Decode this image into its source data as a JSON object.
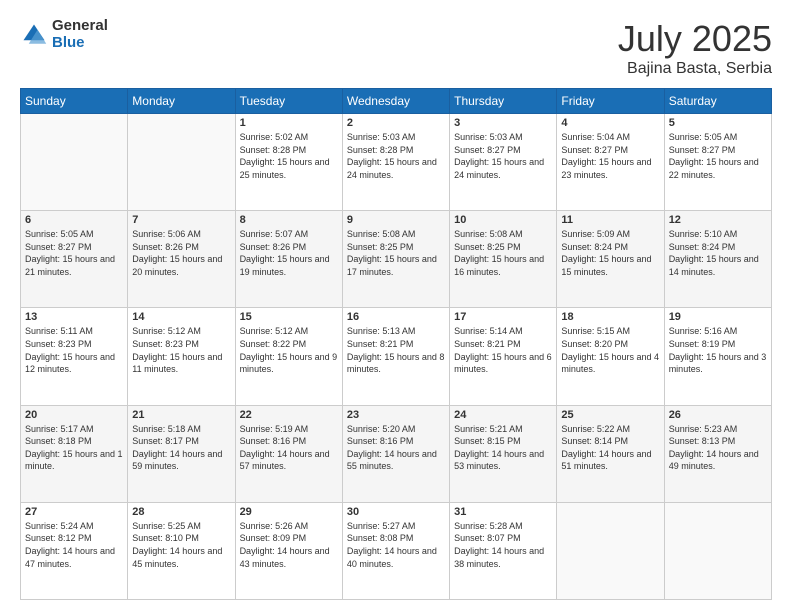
{
  "header": {
    "logo_general": "General",
    "logo_blue": "Blue",
    "main_title": "July 2025",
    "subtitle": "Bajina Basta, Serbia"
  },
  "weekdays": [
    "Sunday",
    "Monday",
    "Tuesday",
    "Wednesday",
    "Thursday",
    "Friday",
    "Saturday"
  ],
  "weeks": [
    [
      {
        "day": "",
        "info": ""
      },
      {
        "day": "",
        "info": ""
      },
      {
        "day": "1",
        "info": "Sunrise: 5:02 AM\nSunset: 8:28 PM\nDaylight: 15 hours and 25 minutes."
      },
      {
        "day": "2",
        "info": "Sunrise: 5:03 AM\nSunset: 8:28 PM\nDaylight: 15 hours and 24 minutes."
      },
      {
        "day": "3",
        "info": "Sunrise: 5:03 AM\nSunset: 8:27 PM\nDaylight: 15 hours and 24 minutes."
      },
      {
        "day": "4",
        "info": "Sunrise: 5:04 AM\nSunset: 8:27 PM\nDaylight: 15 hours and 23 minutes."
      },
      {
        "day": "5",
        "info": "Sunrise: 5:05 AM\nSunset: 8:27 PM\nDaylight: 15 hours and 22 minutes."
      }
    ],
    [
      {
        "day": "6",
        "info": "Sunrise: 5:05 AM\nSunset: 8:27 PM\nDaylight: 15 hours and 21 minutes."
      },
      {
        "day": "7",
        "info": "Sunrise: 5:06 AM\nSunset: 8:26 PM\nDaylight: 15 hours and 20 minutes."
      },
      {
        "day": "8",
        "info": "Sunrise: 5:07 AM\nSunset: 8:26 PM\nDaylight: 15 hours and 19 minutes."
      },
      {
        "day": "9",
        "info": "Sunrise: 5:08 AM\nSunset: 8:25 PM\nDaylight: 15 hours and 17 minutes."
      },
      {
        "day": "10",
        "info": "Sunrise: 5:08 AM\nSunset: 8:25 PM\nDaylight: 15 hours and 16 minutes."
      },
      {
        "day": "11",
        "info": "Sunrise: 5:09 AM\nSunset: 8:24 PM\nDaylight: 15 hours and 15 minutes."
      },
      {
        "day": "12",
        "info": "Sunrise: 5:10 AM\nSunset: 8:24 PM\nDaylight: 15 hours and 14 minutes."
      }
    ],
    [
      {
        "day": "13",
        "info": "Sunrise: 5:11 AM\nSunset: 8:23 PM\nDaylight: 15 hours and 12 minutes."
      },
      {
        "day": "14",
        "info": "Sunrise: 5:12 AM\nSunset: 8:23 PM\nDaylight: 15 hours and 11 minutes."
      },
      {
        "day": "15",
        "info": "Sunrise: 5:12 AM\nSunset: 8:22 PM\nDaylight: 15 hours and 9 minutes."
      },
      {
        "day": "16",
        "info": "Sunrise: 5:13 AM\nSunset: 8:21 PM\nDaylight: 15 hours and 8 minutes."
      },
      {
        "day": "17",
        "info": "Sunrise: 5:14 AM\nSunset: 8:21 PM\nDaylight: 15 hours and 6 minutes."
      },
      {
        "day": "18",
        "info": "Sunrise: 5:15 AM\nSunset: 8:20 PM\nDaylight: 15 hours and 4 minutes."
      },
      {
        "day": "19",
        "info": "Sunrise: 5:16 AM\nSunset: 8:19 PM\nDaylight: 15 hours and 3 minutes."
      }
    ],
    [
      {
        "day": "20",
        "info": "Sunrise: 5:17 AM\nSunset: 8:18 PM\nDaylight: 15 hours and 1 minute."
      },
      {
        "day": "21",
        "info": "Sunrise: 5:18 AM\nSunset: 8:17 PM\nDaylight: 14 hours and 59 minutes."
      },
      {
        "day": "22",
        "info": "Sunrise: 5:19 AM\nSunset: 8:16 PM\nDaylight: 14 hours and 57 minutes."
      },
      {
        "day": "23",
        "info": "Sunrise: 5:20 AM\nSunset: 8:16 PM\nDaylight: 14 hours and 55 minutes."
      },
      {
        "day": "24",
        "info": "Sunrise: 5:21 AM\nSunset: 8:15 PM\nDaylight: 14 hours and 53 minutes."
      },
      {
        "day": "25",
        "info": "Sunrise: 5:22 AM\nSunset: 8:14 PM\nDaylight: 14 hours and 51 minutes."
      },
      {
        "day": "26",
        "info": "Sunrise: 5:23 AM\nSunset: 8:13 PM\nDaylight: 14 hours and 49 minutes."
      }
    ],
    [
      {
        "day": "27",
        "info": "Sunrise: 5:24 AM\nSunset: 8:12 PM\nDaylight: 14 hours and 47 minutes."
      },
      {
        "day": "28",
        "info": "Sunrise: 5:25 AM\nSunset: 8:10 PM\nDaylight: 14 hours and 45 minutes."
      },
      {
        "day": "29",
        "info": "Sunrise: 5:26 AM\nSunset: 8:09 PM\nDaylight: 14 hours and 43 minutes."
      },
      {
        "day": "30",
        "info": "Sunrise: 5:27 AM\nSunset: 8:08 PM\nDaylight: 14 hours and 40 minutes."
      },
      {
        "day": "31",
        "info": "Sunrise: 5:28 AM\nSunset: 8:07 PM\nDaylight: 14 hours and 38 minutes."
      },
      {
        "day": "",
        "info": ""
      },
      {
        "day": "",
        "info": ""
      }
    ]
  ]
}
